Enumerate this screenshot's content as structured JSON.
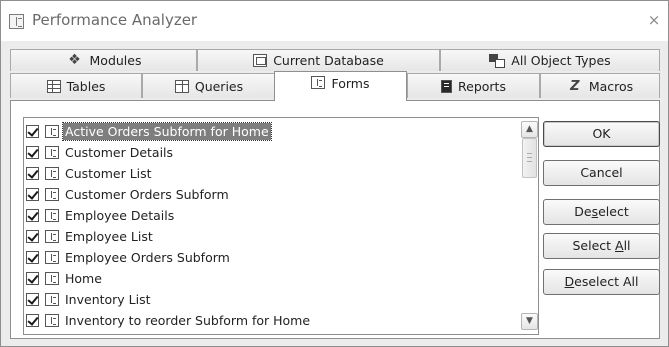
{
  "window": {
    "title": "Performance Analyzer",
    "close_glyph": "×"
  },
  "tabs_row1": [
    {
      "label": "Modules",
      "icon": "modules-icon"
    },
    {
      "label": "Current Database",
      "icon": "database-icon"
    },
    {
      "label": "All Object Types",
      "icon": "all-object-types-icon"
    }
  ],
  "tabs_row2": [
    {
      "label": "Tables",
      "icon": "table-icon"
    },
    {
      "label": "Queries",
      "icon": "query-icon"
    },
    {
      "label": "Forms",
      "icon": "form-icon",
      "active": true
    },
    {
      "label": "Reports",
      "icon": "report-icon"
    },
    {
      "label": "Macros",
      "icon": "macro-icon"
    }
  ],
  "list": {
    "items": [
      {
        "label": "Active Orders Subform for Home",
        "checked": true,
        "selected": true
      },
      {
        "label": "Customer Details",
        "checked": true
      },
      {
        "label": "Customer List",
        "checked": true
      },
      {
        "label": "Customer Orders Subform",
        "checked": true
      },
      {
        "label": "Employee Details",
        "checked": true
      },
      {
        "label": "Employee List",
        "checked": true
      },
      {
        "label": "Employee Orders Subform",
        "checked": true
      },
      {
        "label": "Home",
        "checked": true
      },
      {
        "label": "Inventory List",
        "checked": true
      },
      {
        "label": "Inventory to reorder Subform for Home",
        "checked": true
      }
    ],
    "scroll_up_glyph": "▲",
    "scroll_down_glyph": "▼"
  },
  "buttons": {
    "ok": "OK",
    "cancel": "Cancel",
    "deselect_pre": "De",
    "deselect_key": "s",
    "deselect_post": "elect",
    "select_all_pre": "Select ",
    "select_all_key": "A",
    "select_all_post": "ll",
    "deselect_all_key": "D",
    "deselect_all_post": "eselect All"
  }
}
